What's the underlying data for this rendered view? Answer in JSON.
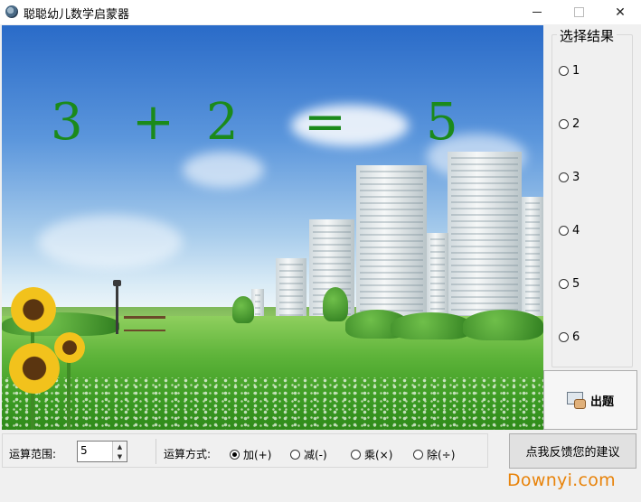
{
  "window": {
    "title": "聪聪幼儿数学启蒙器",
    "min_label": "",
    "max_label": "",
    "close_label": "✕"
  },
  "equation": {
    "operand1": "3",
    "operator": "+",
    "operand2": "2",
    "equals": "=",
    "answer": "5"
  },
  "results": {
    "legend": "选择结果",
    "options": [
      "1",
      "2",
      "3",
      "4",
      "5",
      "6"
    ]
  },
  "question_button": {
    "label": "出题"
  },
  "range": {
    "label": "运算范围:",
    "value": "5",
    "up": "▲",
    "down": "▼"
  },
  "operations": {
    "label": "运算方式:",
    "items": [
      "加(+)",
      "减(-)",
      "乘(×)",
      "除(÷)"
    ],
    "selected": "加(+)"
  },
  "feedback_button": {
    "label": "点我反馈您的建议"
  },
  "watermark": "Downyi.com",
  "colors": {
    "equation": "#1b8a1b",
    "watermark": "#e8830a"
  }
}
